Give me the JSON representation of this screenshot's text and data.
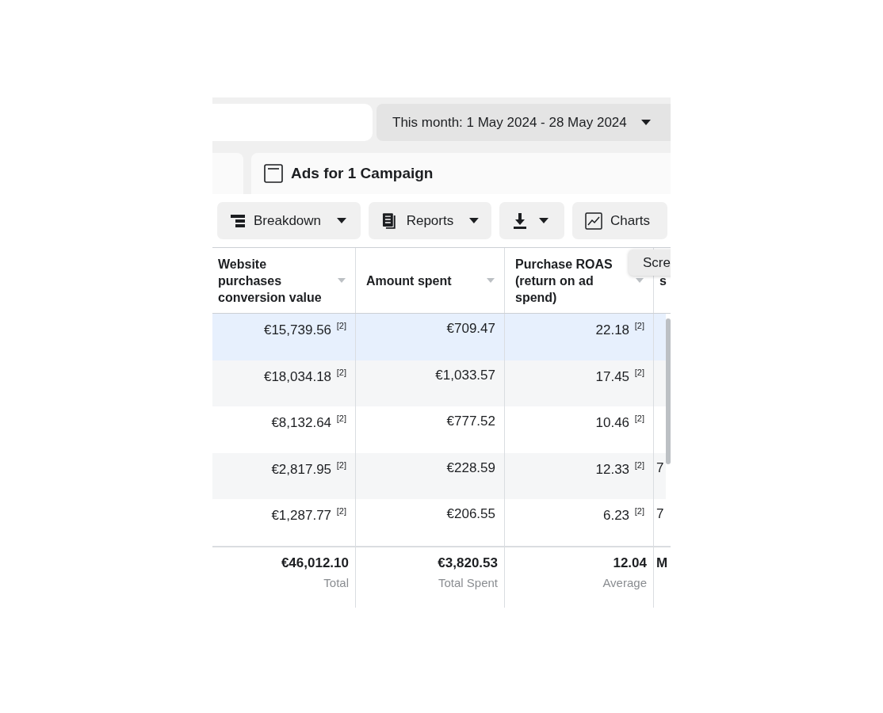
{
  "date_range": {
    "label": "This month: 1 May 2024 - 28 May 2024"
  },
  "tab": {
    "title": "Ads for 1 Campaign"
  },
  "toolbar": [
    {
      "kind": "breakdown",
      "label": "Breakdown",
      "dropdown": true
    },
    {
      "kind": "reports",
      "label": "Reports",
      "dropdown": true
    },
    {
      "kind": "export",
      "dropdown": true
    },
    {
      "kind": "charts",
      "label": "Charts",
      "dropdown": false
    }
  ],
  "tooltip": "Scre",
  "table": {
    "columns": [
      {
        "label": "Website purchases conversion value",
        "sortable": true
      },
      {
        "label": "Amount spent",
        "sortable": true
      },
      {
        "label": "Purchase ROAS (return on ad spend)",
        "sortable": true
      },
      {
        "label": "s",
        "sortable": false
      }
    ],
    "rows": [
      {
        "selected": true,
        "cells": [
          "€15,739.56 $^{[2]}$",
          "€709.47",
          "22.18 $^{[2]}$",
          ""
        ]
      },
      {
        "selected": false,
        "cells": [
          "€18,034.18 $^{[2]}$",
          "€1,033.57",
          "17.45 $^{[2]}$",
          ""
        ]
      },
      {
        "selected": false,
        "cells": [
          "€8,132.64 $^{[2]}$",
          "€777.52",
          "10.46 $^{[2]}$",
          ""
        ]
      },
      {
        "selected": false,
        "cells": [
          "€2,817.95 $^{[2]}$",
          "€228.59",
          "12.33 $^{[2]}$",
          "7"
        ]
      },
      {
        "selected": false,
        "cells": [
          "€1,287.77 $^{[2]}$",
          "€206.55",
          "6.23 $^{[2]}$",
          "7"
        ]
      }
    ],
    "totals": [
      {
        "value": "€46,012.10",
        "label": "Total"
      },
      {
        "value": "€3,820.53",
        "label": "Total Spent"
      },
      {
        "value": "12.04",
        "label": "Average"
      },
      {
        "value": "M"
      }
    ]
  }
}
